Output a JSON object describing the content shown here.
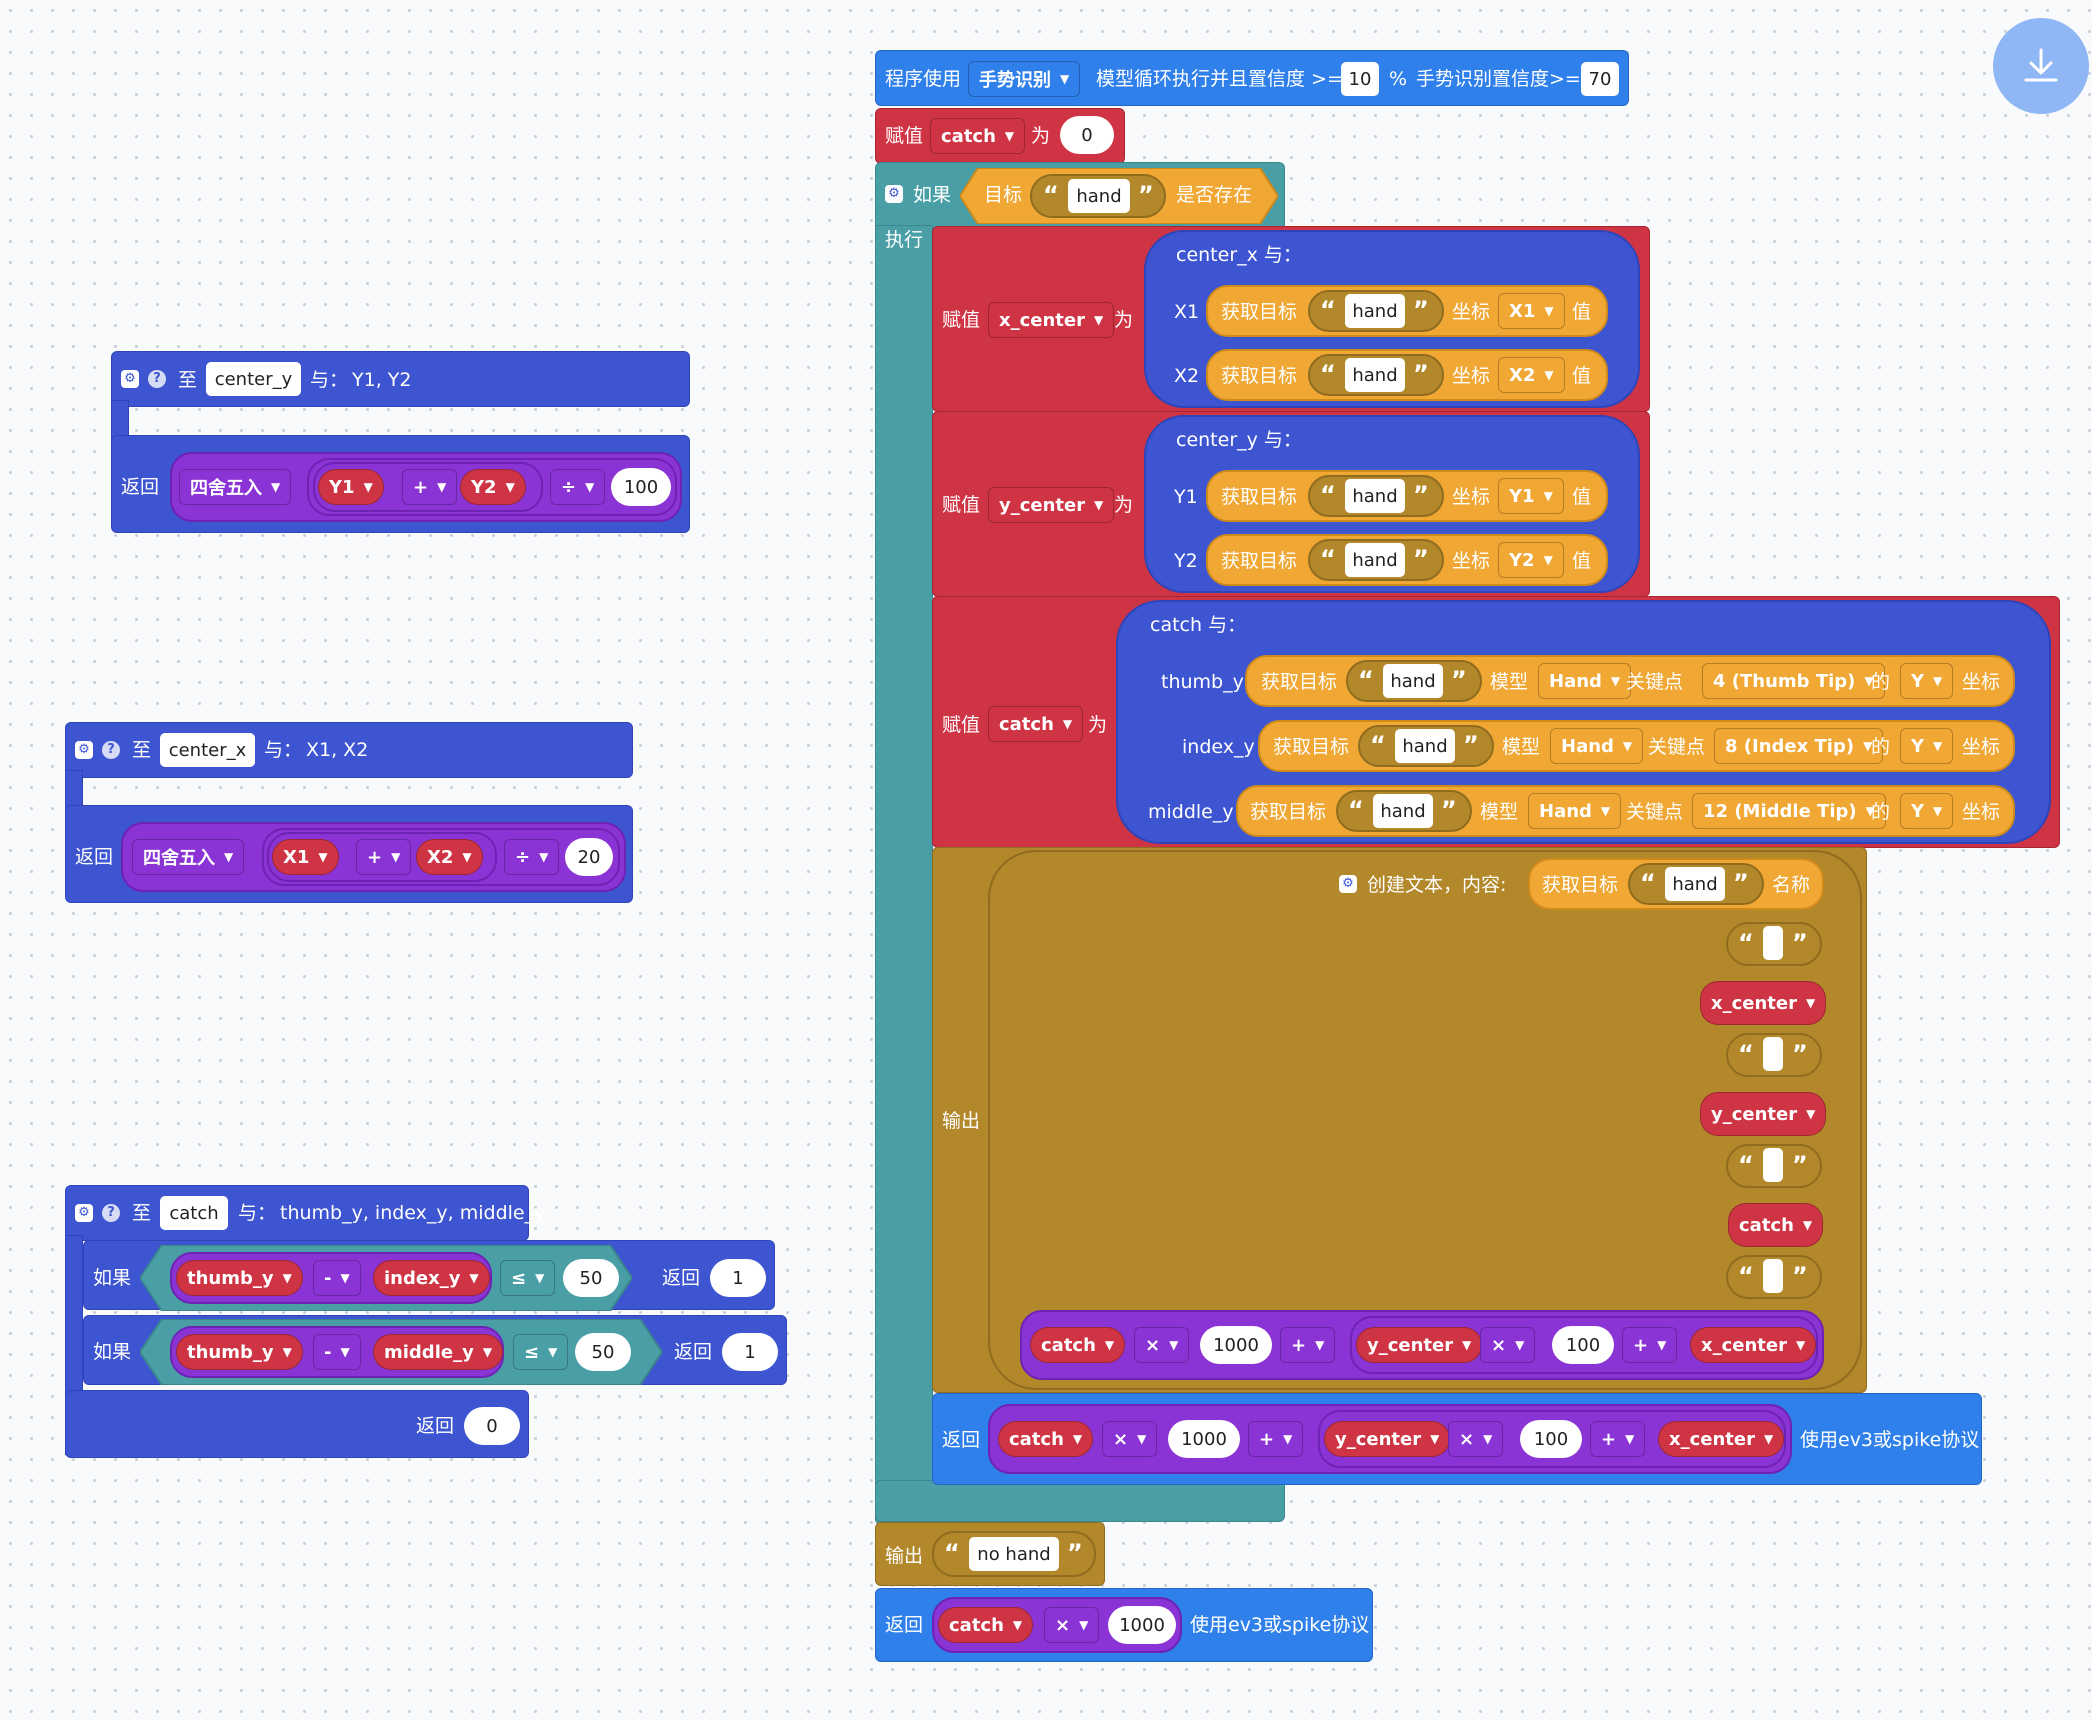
{
  "toolbar": {
    "download_icon": "download-icon"
  },
  "common": {
    "assign": "赋值",
    "as": "为",
    "if": "如果",
    "do": "执行",
    "output": "输出",
    "return": "返回",
    "to": "至",
    "with": "与：",
    "hand": "hand",
    "get_target": "获取目标",
    "coord": "坐标",
    "value": "值",
    "model": "模型",
    "keypoint": "关键点",
    "of": "的",
    "coord2": "坐标",
    "round": "四舍五入",
    "plus": "+",
    "minus": "-",
    "times": "×",
    "div": "÷",
    "le": "≤",
    "name": "名称"
  },
  "func_center_y": {
    "name": "center_y",
    "params": "Y1, Y2",
    "a": "Y1",
    "b": "Y2",
    "divisor": "100"
  },
  "func_center_x": {
    "name": "center_x",
    "params": "X1, X2",
    "a": "X1",
    "b": "X2",
    "divisor": "20"
  },
  "func_catch": {
    "name": "catch",
    "params": "thumb_y, index_y, middle_y",
    "a": "thumb_y",
    "b": "index_y",
    "c": "middle_y",
    "threshold": "50",
    "ret1": "1",
    "ret0": "0"
  },
  "main": {
    "header_prefix": "程序使用",
    "model": "手势识别",
    "header_mid": "模型循环执行并且置信度 >=",
    "conf1": "10",
    "pct": "%",
    "header_tail": "手势识别置信度>=",
    "conf2": "70",
    "catch_var": "catch",
    "catch_init": "0",
    "target": "目标",
    "exists": "是否存在",
    "x_center": "x_center",
    "y_center": "y_center",
    "call_cx": "center_x 与：",
    "call_cy": "center_y 与：",
    "call_catch": "catch 与：",
    "X1": "X1",
    "X2": "X2",
    "Y1": "Y1",
    "Y2": "Y2",
    "thumb_y": "thumb_y",
    "index_y": "index_y",
    "middle_y": "middle_y",
    "Hand": "Hand",
    "kp_thumb": "4 (Thumb Tip)",
    "kp_index": "8 (Index Tip)",
    "kp_middle": "12 (Middle Tip)",
    "Y": "Y",
    "create_text": "创建文本，内容:",
    "n1000": "1000",
    "n100": "100",
    "proto": "使用ev3或spike协议",
    "no_hand": "no hand"
  }
}
